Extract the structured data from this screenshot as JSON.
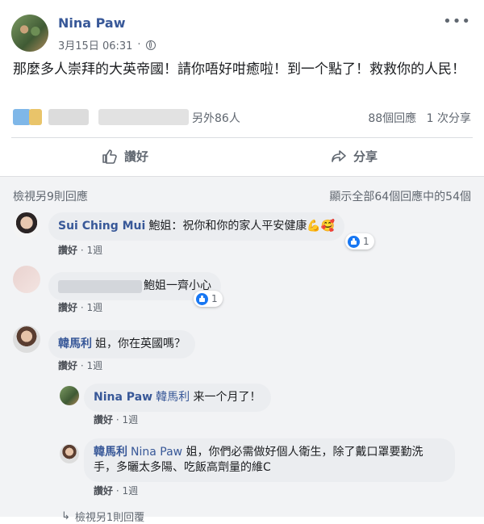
{
  "post": {
    "author": "Nina Paw",
    "timestamp": "3月15日 06:31",
    "privacy_icon": "globe-icon",
    "text": "那麼多人崇拜的大英帝國！請你唔好咁癒啦！到一个點了！救救你的人民！",
    "likers_suffix": "另外86人",
    "comment_count": "88個回應",
    "share_count": "1 次分享",
    "like_label": "讚好",
    "share_label": "分享"
  },
  "comments_header": {
    "view_more": "檢視另9則回應",
    "shown_count": "顯示全部64個回應中的54個"
  },
  "comments": [
    {
      "author": "Sui Ching Mui",
      "text": "鮑姐：祝你和你的家人平安健康💪🥰",
      "like": "讚好",
      "time": "1週",
      "reactions": "1"
    },
    {
      "author": "",
      "text": "鮑姐一齊小心",
      "like": "讚好",
      "time": "1週",
      "reactions": "1"
    },
    {
      "author": "韓馬利",
      "text": "姐，你在英國嗎？",
      "like": "讚好",
      "time": "1週"
    }
  ],
  "replies": [
    {
      "author": "Nina Paw",
      "mention": "韓馬利",
      "text": "来一个月了！",
      "like": "讚好",
      "time": "1週"
    },
    {
      "author": "韓馬利",
      "mention": "Nina Paw",
      "text": "姐，你們必需做好個人衛生，除了戴口罩要勤洗手，多曬太多陽、吃飯高劑量的維C",
      "like": "讚好",
      "time": "1週"
    }
  ],
  "footer": {
    "view_replies": "檢視另1則回覆"
  },
  "colors": {
    "link": "#385898",
    "like_blue": "#1877f2",
    "comment_bg": "#f2f3f5",
    "bubble_bg": "#ebedf0"
  }
}
